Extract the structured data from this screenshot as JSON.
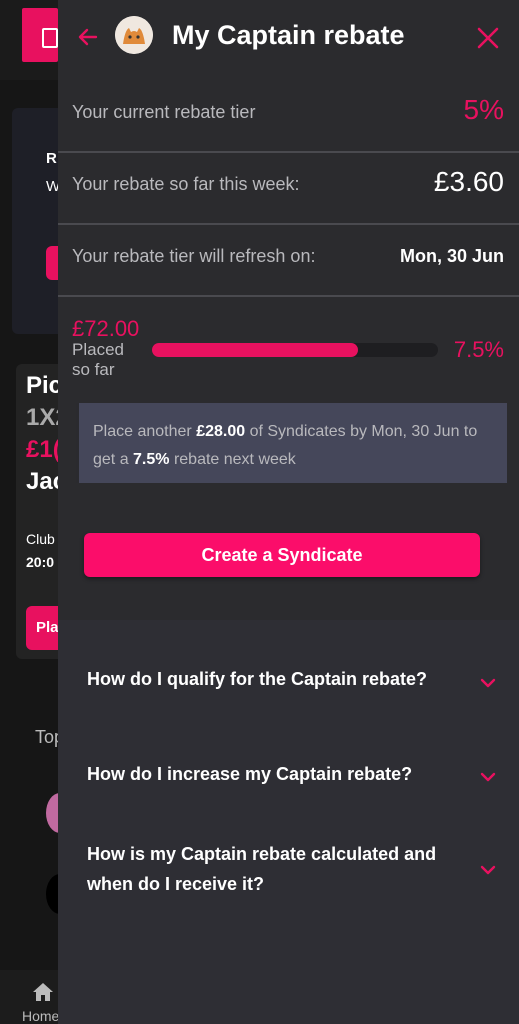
{
  "background": {
    "card1_line1": "R",
    "card1_line2": "W",
    "card2_lines": [
      "Pic",
      "1X2",
      "£1(",
      "Jac"
    ],
    "card2_club": "Club",
    "card2_time": "20:0",
    "card2_button": "Pla",
    "section_label": "Top",
    "nav_home": "Home"
  },
  "drawer": {
    "title": "My Captain rebate",
    "rows": [
      {
        "label": "Your current rebate tier",
        "value": "5%"
      },
      {
        "label": "Your rebate so far this week:",
        "value": "£3.60"
      },
      {
        "label": "Your rebate tier will refresh on:",
        "value": "Mon, 30 Jun"
      }
    ],
    "progress": {
      "placed_amount": "£72.00",
      "placed_label": "Placed so far",
      "next_tier": "7.5%",
      "fraction": 0.72
    },
    "info": {
      "part1": "Place another ",
      "amount": "£28.00",
      "part2": " of Syndicates by Mon, 30 Jun to get a ",
      "tier": "7.5%",
      "part3": " rebate next week"
    },
    "cta_label": "Create a Syndicate",
    "faqs": [
      "How do I qualify for the Captain rebate?",
      "How do I increase my Captain rebate?",
      "How is my Captain rebate calculated and when do I receive it?"
    ]
  },
  "colors": {
    "accent": "#e8115f",
    "cta": "#fb0d6a",
    "panel": "#2b2b2e",
    "info_box": "#45475a"
  },
  "icons": {
    "back": "back-arrow-icon",
    "close": "close-icon",
    "chevron": "chevron-down-icon",
    "home": "home-icon"
  }
}
